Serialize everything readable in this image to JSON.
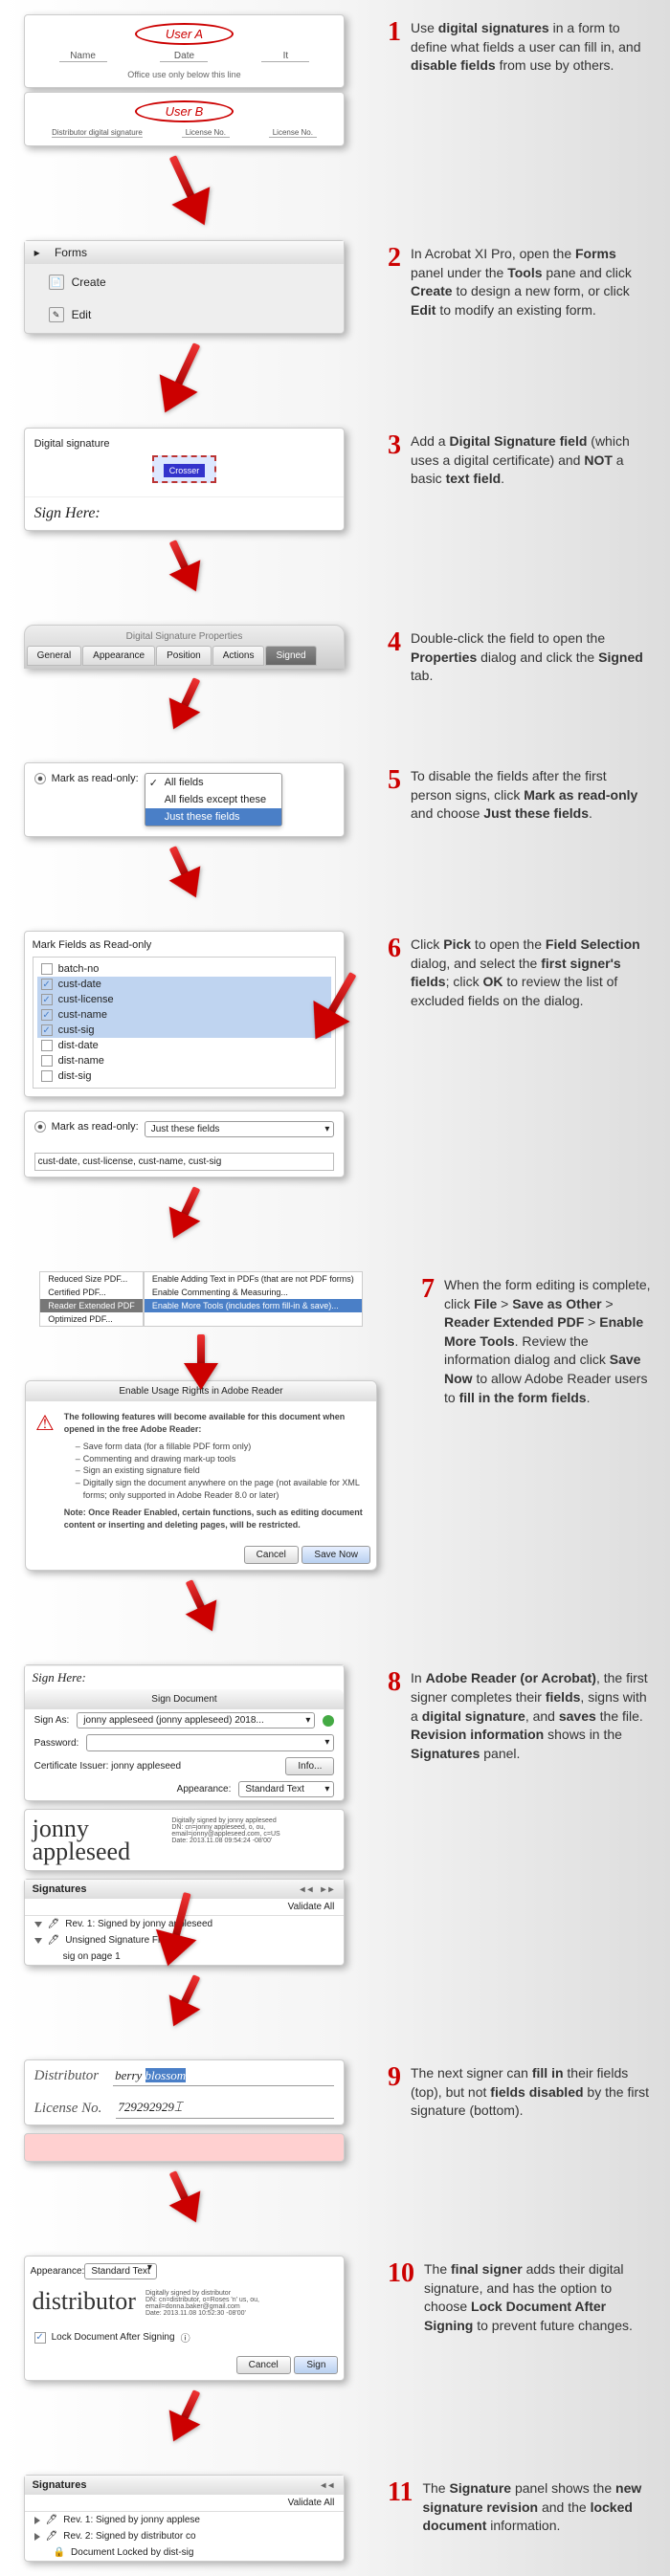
{
  "steps": {
    "s1": {
      "num": "1",
      "textA": "Use ",
      "b1": "digital signatures",
      "textB": " in a form to define what fields a user can fill in, and ",
      "b2": "disable fields",
      "textC": " from use by others."
    },
    "s2": {
      "num": "2",
      "textA": "In Acrobat XI Pro, open the ",
      "b1": "Forms",
      "textB": " panel under the ",
      "b2": "Tools",
      "textC": " pane and click ",
      "b3": "Create",
      "textD": " to design a new form, or click ",
      "b4": "Edit",
      "textE": " to modify an existing form."
    },
    "s3": {
      "num": "3",
      "textA": "Add a ",
      "b1": "Digital Signature field",
      "textB": " (which uses a digital certificate) and ",
      "b2": "NOT",
      "textC": " a basic ",
      "b3": "text field",
      "textD": "."
    },
    "s4": {
      "num": "4",
      "textA": "Double-click the field to open the ",
      "b1": "Properties",
      "textB": " dialog and click the ",
      "b2": "Signed",
      "textC": " tab."
    },
    "s5": {
      "num": "5",
      "textA": "To disable the fields after the first person signs, click ",
      "b1": "Mark as read-only",
      "textB": " and choose ",
      "b2": "Just these fields",
      "textC": "."
    },
    "s6": {
      "num": "6",
      "textA": "Click ",
      "b1": "Pick",
      "textB": " to open the ",
      "b2": "Field Selection",
      "textC": " dialog, and select the ",
      "b3": "first signer's fields",
      "textD": "; click ",
      "b4": "OK",
      "textE": " to review the list of excluded fields on the dialog."
    },
    "s7": {
      "num": "7",
      "textA": "When the form editing is complete, click ",
      "b1": "File",
      "textB": " > ",
      "b2": "Save as Other",
      "textC": " > ",
      "b3": "Reader Extended PDF",
      "textD": " > ",
      "b4": "Enable More Tools",
      "textE": ". Review the information dialog and click ",
      "b5": "Save Now",
      "textF": " to allow Adobe Reader users to ",
      "b6": "fill in the form fields",
      "textG": "."
    },
    "s8": {
      "num": "8",
      "textA": "In ",
      "b1": "Adobe Reader (or Acrobat)",
      "textB": ", the first signer completes their ",
      "b2": "fields",
      "textC": ", signs with a ",
      "b3": "digital signature",
      "textD": ", and ",
      "b4": "saves",
      "textE": " the file. ",
      "b5": "Revision information",
      "textF": " shows in the ",
      "b6": "Signatures",
      "textG": " panel."
    },
    "s9": {
      "num": "9",
      "textA": "The next signer can ",
      "b1": "fill in",
      "textB": " their fields (top), but not ",
      "b2": "fields disabled",
      "textC": " by the first signature (bottom)."
    },
    "s10": {
      "num": "10",
      "textA": "The ",
      "b1": "final signer",
      "textB": " adds their digital signature, and has the option to choose ",
      "b2": "Lock Document After Signing",
      "textC": " to prevent future changes."
    },
    "s11": {
      "num": "11",
      "textA": "The ",
      "b1": "Signature",
      "textB": " panel shows the ",
      "b2": "new signature revision",
      "textC": " and the ",
      "b3": "locked document",
      "textD": " information."
    }
  },
  "step1": {
    "userA": "User A",
    "userB": "User B",
    "lbls": {
      "name": "Name",
      "date": "Date",
      "it": "It",
      "officeuse": "Office use only below this line",
      "distsig": "Distributor digital signature",
      "licno": "License No.",
      "licdate": "License No."
    }
  },
  "step2": {
    "forms": "Forms",
    "create": "Create",
    "edit": "Edit",
    "triangle": "▸"
  },
  "step3": {
    "label": "Digital signature",
    "tag": "Crosser",
    "signhere": "Sign Here:"
  },
  "step4": {
    "title": "Digital Signature Properties",
    "tabs": [
      "General",
      "Appearance",
      "Position",
      "Actions",
      "Signed"
    ]
  },
  "step5": {
    "label": "Mark as read-only:",
    "options": [
      "All fields",
      "All fields except these",
      "Just these fields"
    ]
  },
  "step6": {
    "title": "Mark Fields as Read-only",
    "fields": [
      {
        "name": "batch-no",
        "checked": false
      },
      {
        "name": "cust-date",
        "checked": true
      },
      {
        "name": "cust-license",
        "checked": true
      },
      {
        "name": "cust-name",
        "checked": true
      },
      {
        "name": "cust-sig",
        "checked": true
      },
      {
        "name": "dist-date",
        "checked": false
      },
      {
        "name": "dist-name",
        "checked": false
      },
      {
        "name": "dist-sig",
        "checked": false
      }
    ],
    "label": "Mark as read-only:",
    "sel": "Just these fields",
    "excluded": "cust-date, cust-license, cust-name, cust-sig"
  },
  "step7": {
    "menuL": [
      "Reduced Size PDF...",
      "Certified PDF...",
      "Reader Extended PDF",
      "Optimized PDF..."
    ],
    "menuR": [
      "Enable Adding Text in PDFs (that are not PDF forms)",
      "Enable Commenting & Measuring...",
      "Enable More Tools (includes form fill-in & save)..."
    ],
    "dlgTitle": "Enable Usage Rights in Adobe Reader",
    "intro": "The following features will become available for this document when opened in the free Adobe Reader:",
    "feats": [
      "Save form data (for a fillable PDF form only)",
      "Commenting and drawing mark-up tools",
      "Sign an existing signature field",
      "Digitally sign the document anywhere on the page (not available for XML forms; only supported in Adobe Reader 8.0 or later)"
    ],
    "note": "Note: Once Reader Enabled, certain functions, such as editing document content or inserting and deleting pages, will be restricted.",
    "cancel": "Cancel",
    "save": "Save Now"
  },
  "step8": {
    "signhere": "Sign Here:",
    "dlgTitle": "Sign Document",
    "signAs": "Sign As:",
    "signAsVal": "jonny appleseed (jonny appleseed) 2018...",
    "pwd": "Password:",
    "cert": "Certificate Issuer: jonny appleseed",
    "info": "Info...",
    "app": "Appearance:",
    "appVal": "Standard Text",
    "sigName": "jonny appleseed",
    "sigDet1": "Digitally signed by jonny appleseed",
    "sigDet2": "DN: cn=jonny appleseed, o, ou, email=jonny@appleseed.com, c=US",
    "sigDet3": "Date: 2013.11.08 09:54:24 -08'00'",
    "panelTitle": "Signatures",
    "validate": "Validate All",
    "rev1": "Rev. 1: Signed by jonny appleseed",
    "unsigned": "Unsigned Signature Fields",
    "sigon": "sig on page 1"
  },
  "step9": {
    "dist": "Distributor",
    "distVal1": "berry ",
    "distVal2": "blossom",
    "lic": "License No.",
    "licVal": "729292929",
    "cursor": "⌶"
  },
  "step10": {
    "app": "Appearance:",
    "appVal": "Standard Text",
    "sigName": "distributor",
    "sigDet1": "Digitally signed by distributor",
    "sigDet2": "DN: cn=distributor, o=Roses 'n' us, ou, email=donna.baker@gmail.com",
    "sigDet3": "Date: 2013.11.08 10:52:30 -08'00'",
    "lock": "Lock Document After Signing",
    "cancel": "Cancel",
    "sign": "Sign"
  },
  "step11": {
    "panelTitle": "Signatures",
    "validate": "Validate All",
    "rev1": "Rev. 1: Signed by jonny applese",
    "rev2": "Rev. 2: Signed by distributor co",
    "locked": "Document Locked by dist-sig"
  }
}
